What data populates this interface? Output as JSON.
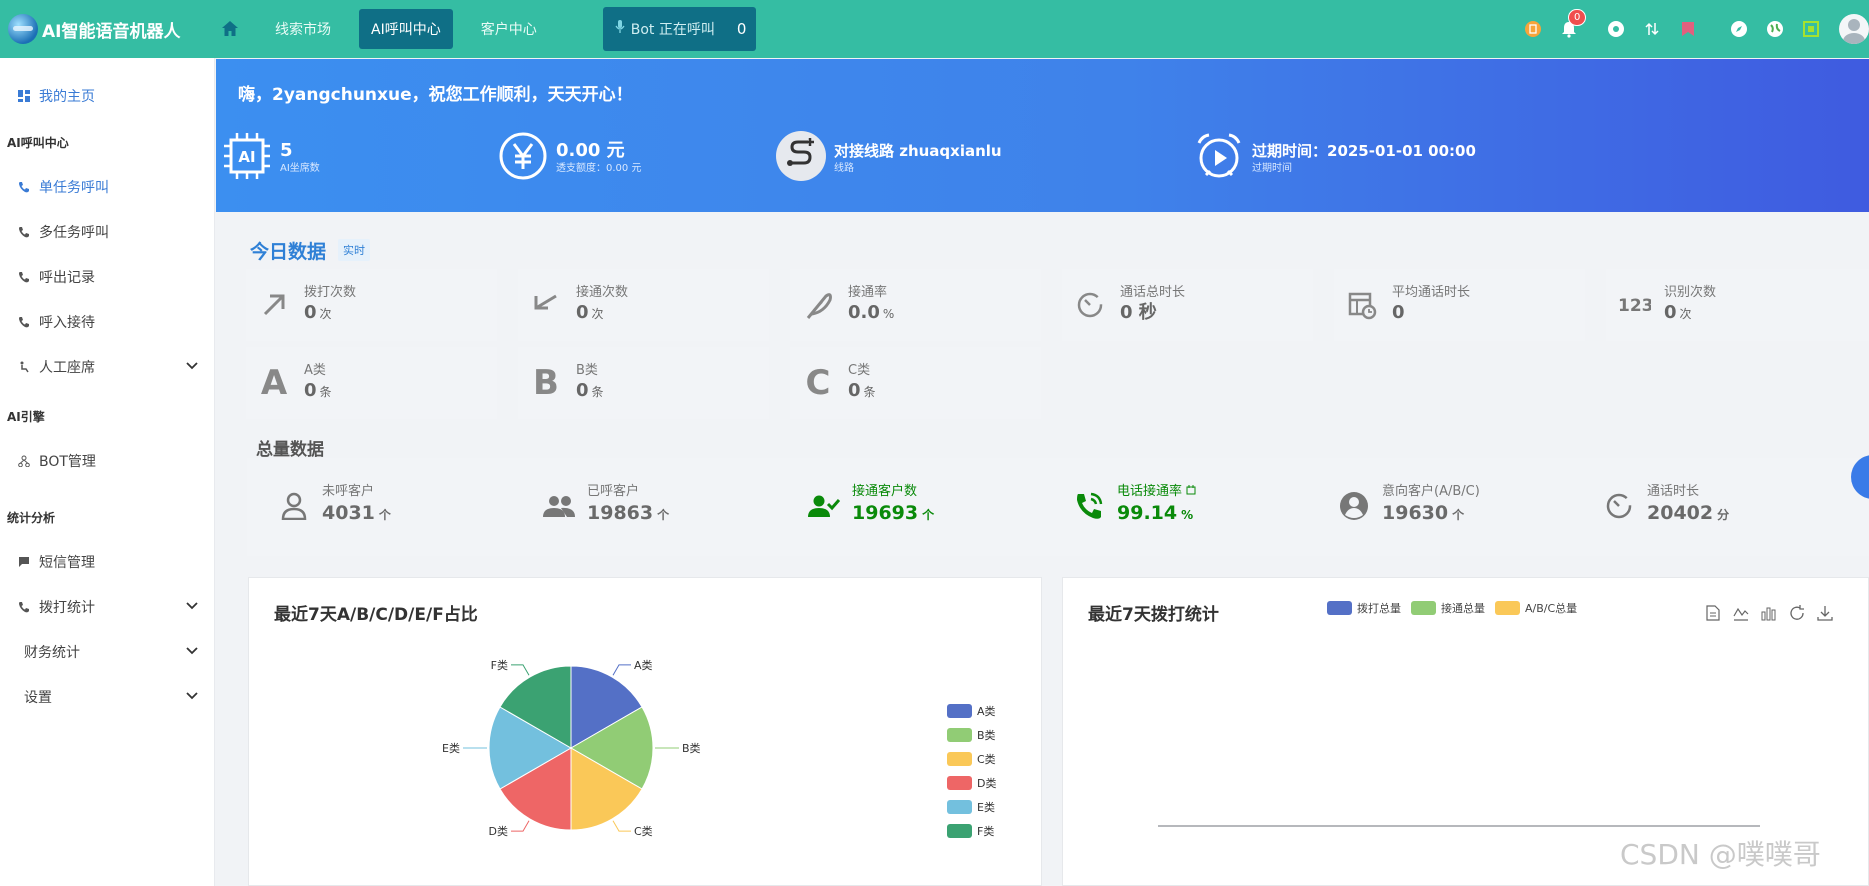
{
  "brand": {
    "name": "AI智能语音机器人"
  },
  "nav": {
    "links": [
      "线索市场",
      "AI呼叫中心",
      "客户中心"
    ],
    "active": "AI呼叫中心",
    "bot_status_label": "Bot 正在呼叫",
    "bot_status_count": "0",
    "notification_count": "0"
  },
  "sidebar": {
    "home": "我的主页",
    "section_ai_call": "AI呼叫中心",
    "single_call": "单任务呼叫",
    "multi_call": "多任务呼叫",
    "outbound_records": "呼出记录",
    "inbound_answer": "呼入接待",
    "manual_agent": "人工座席",
    "section_ai_engine": "AI引擎",
    "bot_manage": "BOT管理",
    "section_stats": "统计分析",
    "sms_manage": "短信管理",
    "dial_stats": "拨打统计",
    "finance_stats": "财务统计",
    "settings": "设置"
  },
  "banner": {
    "greeting": "嗨，2yangchunxue，祝您工作顺利，天天开心！",
    "ai_seats_value": "5",
    "ai_seats_label": "AI坐席数",
    "balance_value": "0.00 元",
    "balance_label": "透支额度：0.00 元",
    "line_value": "对接线路 zhuaqxianlu",
    "line_label": "线路",
    "expire_value": "过期时间：2025-01-01 00:00",
    "expire_label": "过期时间"
  },
  "today": {
    "title": "今日数据",
    "badge": "实时",
    "cards": [
      {
        "label": "拨打次数",
        "value": "0",
        "unit": "次"
      },
      {
        "label": "接通次数",
        "value": "0",
        "unit": "次"
      },
      {
        "label": "接通率",
        "value": "0.0",
        "unit": "%"
      },
      {
        "label": "通话总时长",
        "value": "0 秒",
        "unit": ""
      },
      {
        "label": "平均通话时长",
        "value": "0",
        "unit": ""
      },
      {
        "label": "识别次数",
        "value": "0",
        "unit": "次"
      },
      {
        "label": "A类",
        "value": "0",
        "unit": "条",
        "letter": "A"
      },
      {
        "label": "B类",
        "value": "0",
        "unit": "条",
        "letter": "B"
      },
      {
        "label": "C类",
        "value": "0",
        "unit": "条",
        "letter": "C"
      }
    ]
  },
  "total": {
    "title": "总量数据",
    "stats": [
      {
        "label": "未呼客户",
        "value": "4031",
        "unit": "个"
      },
      {
        "label": "已呼客户",
        "value": "19863",
        "unit": "个"
      },
      {
        "label": "接通客户数",
        "value": "19693",
        "unit": "个"
      },
      {
        "label": "电话接通率",
        "value": "99.14",
        "unit": "%"
      },
      {
        "label": "意向客户(A/B/C)",
        "value": "19630",
        "unit": "个"
      },
      {
        "label": "通话时长",
        "value": "20402",
        "unit": "分"
      }
    ]
  },
  "chart_data": [
    {
      "type": "pie",
      "title": "最近7天A/B/C/D/E/F占比",
      "categories": [
        "A类",
        "B类",
        "C类",
        "D类",
        "E类",
        "F类"
      ],
      "values": [
        1,
        1,
        1,
        1,
        1,
        1
      ],
      "colors": [
        "#5470c6",
        "#91cc75",
        "#fac858",
        "#ee6666",
        "#73c0de",
        "#3ba272"
      ],
      "legend": "right"
    },
    {
      "type": "line",
      "title": "最近7天拨打统计",
      "series": [
        {
          "name": "拨打总量",
          "values": []
        },
        {
          "name": "接通总量",
          "values": []
        },
        {
          "name": "A/B/C总量",
          "values": []
        }
      ],
      "colors": [
        "#5470c6",
        "#91cc75",
        "#fac858"
      ],
      "legend": "top"
    }
  ],
  "watermark": "CSDN @噗噗哥"
}
